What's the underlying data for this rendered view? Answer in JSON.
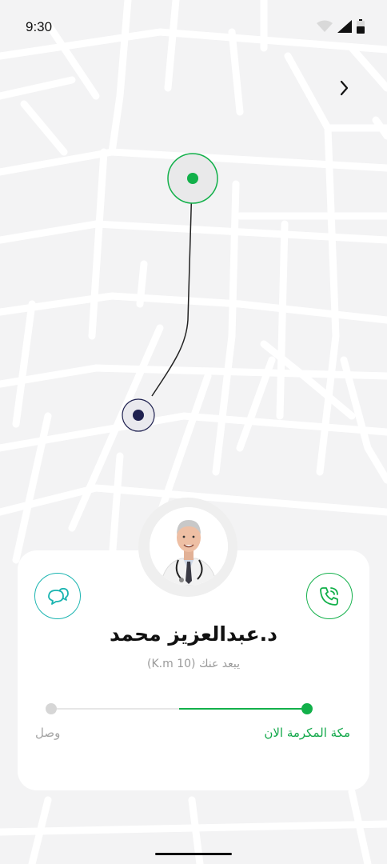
{
  "status_bar": {
    "time": "9:30"
  },
  "map": {
    "accent_color": "#12b04a",
    "user_marker_color": "#1f2150"
  },
  "doctor": {
    "name": "د.عبدالعزيز محمد",
    "distance": "يبعد عنك (10 K.m)"
  },
  "route": {
    "destination_label": "مكة المكرمة الان",
    "arrived_label": "وصل",
    "progress_percent": 50
  },
  "icons": {
    "back": "chevron-right-icon",
    "chat": "chat-bubbles-icon",
    "call": "phone-call-icon"
  }
}
